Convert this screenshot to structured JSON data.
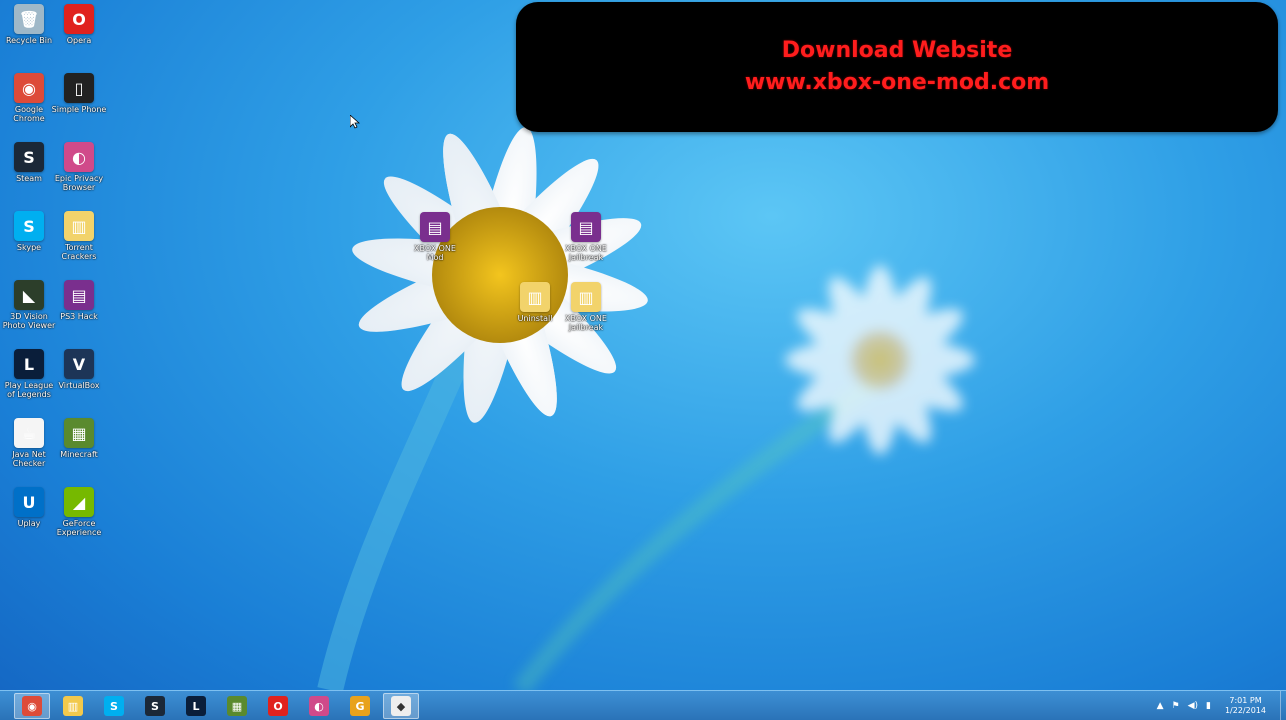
{
  "banner": {
    "line1": "Download Website",
    "line2": "www.xbox-one-mod.com"
  },
  "desktop_icons": [
    {
      "label": "Recycle Bin",
      "icon": "recycle-bin-icon",
      "color": "#9fb8c8",
      "glyph": "🗑"
    },
    {
      "label": "Opera",
      "icon": "opera-icon",
      "color": "#e0221e",
      "glyph": "O"
    },
    {
      "label": "Google Chrome",
      "icon": "chrome-icon",
      "color": "#dd4b39",
      "glyph": "◉"
    },
    {
      "label": "Simple Phone",
      "icon": "phone-icon",
      "color": "#222222",
      "glyph": "▯"
    },
    {
      "label": "Steam",
      "icon": "steam-icon",
      "color": "#1b2838",
      "glyph": "S"
    },
    {
      "label": "Epic Privacy Browser",
      "icon": "epic-browser-icon",
      "color": "#d04a8a",
      "glyph": "◐"
    },
    {
      "label": "Skype",
      "icon": "skype-icon",
      "color": "#00aff0",
      "glyph": "S"
    },
    {
      "label": "Torrent Crackers",
      "icon": "folder-icon",
      "color": "#f2d36b",
      "glyph": "▥"
    },
    {
      "label": "3D Vision Photo Viewer",
      "icon": "nvidia-icon",
      "color": "#2c3e2a",
      "glyph": "◣"
    },
    {
      "label": "PS3 Hack",
      "icon": "winrar-icon",
      "color": "#7a2f8e",
      "glyph": "▤"
    },
    {
      "label": "Play League of Legends",
      "icon": "league-icon",
      "color": "#0a1e3a",
      "glyph": "L"
    },
    {
      "label": "VirtualBox",
      "icon": "virtualbox-icon",
      "color": "#1d3557",
      "glyph": "V"
    },
    {
      "label": "Java Net Checker",
      "icon": "java-icon",
      "color": "#f5f5f5",
      "glyph": "☕"
    },
    {
      "label": "Minecraft",
      "icon": "minecraft-icon",
      "color": "#5a8a2e",
      "glyph": "▦"
    },
    {
      "label": "Uplay",
      "icon": "uplay-icon",
      "color": "#0070c8",
      "glyph": "U"
    },
    {
      "label": "GeForce Experience",
      "icon": "geforce-icon",
      "color": "#76b900",
      "glyph": "◢"
    }
  ],
  "center_icons": [
    {
      "label": "XBOX ONE Mod",
      "icon": "winrar-icon",
      "color": "#7a2f8e",
      "glyph": "▤"
    },
    {
      "label": "XBOX ONE Jailbreak",
      "icon": "winrar-icon",
      "color": "#7a2f8e",
      "glyph": "▤"
    },
    {
      "label": "Uninstall",
      "icon": "folder-icon",
      "color": "#f2d36b",
      "glyph": "▥"
    },
    {
      "label": "XBOX ONE Jailbreak",
      "icon": "folder-icon",
      "color": "#f2d36b",
      "glyph": "▥"
    }
  ],
  "taskbar_apps": [
    {
      "name": "chrome",
      "icon": "chrome-icon",
      "color": "#dd4b39",
      "glyph": "◉",
      "active": true
    },
    {
      "name": "file-explorer",
      "icon": "folder-icon",
      "color": "#f2c94c",
      "glyph": "▥",
      "active": false
    },
    {
      "name": "skype",
      "icon": "skype-icon",
      "color": "#00aff0",
      "glyph": "S",
      "active": false
    },
    {
      "name": "steam",
      "icon": "steam-icon",
      "color": "#1b2838",
      "glyph": "S",
      "active": false
    },
    {
      "name": "league",
      "icon": "league-icon",
      "color": "#0a1e3a",
      "glyph": "L",
      "active": false
    },
    {
      "name": "minecraft",
      "icon": "minecraft-icon",
      "color": "#5a8a2e",
      "glyph": "▦",
      "active": false
    },
    {
      "name": "opera",
      "icon": "opera-icon",
      "color": "#e0221e",
      "glyph": "O",
      "active": false
    },
    {
      "name": "epic-browser",
      "icon": "epic-browser-icon",
      "color": "#d04a8a",
      "glyph": "◐",
      "active": false
    },
    {
      "name": "gom-player",
      "icon": "gom-icon",
      "color": "#e8a21c",
      "glyph": "G",
      "active": false
    },
    {
      "name": "recorder",
      "icon": "recorder-icon",
      "color": "#eeeeee",
      "glyph": "◆",
      "active": true
    }
  ],
  "tray": {
    "time": "7:01 PM",
    "date": "1/22/2014"
  }
}
